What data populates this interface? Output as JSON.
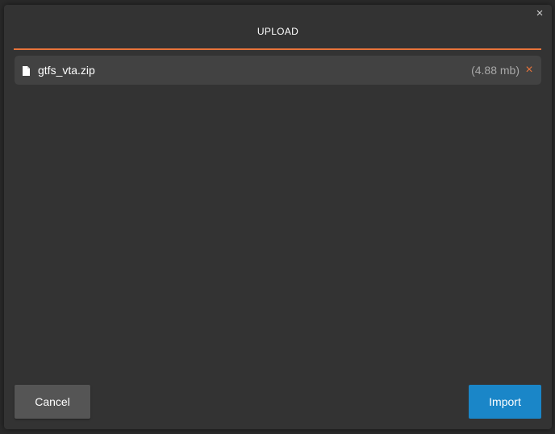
{
  "dialog": {
    "title": "UPLOAD",
    "close_label": "×"
  },
  "file": {
    "name": "gtfs_vta.zip",
    "size": "(4.88 mb)",
    "remove_label": "×",
    "icon": "file-icon"
  },
  "actions": {
    "cancel_label": "Cancel",
    "import_label": "Import"
  },
  "colors": {
    "accent": "#e8743b",
    "primary_button": "#1a86c8",
    "secondary_button": "#555555",
    "dialog_bg": "#333333"
  }
}
